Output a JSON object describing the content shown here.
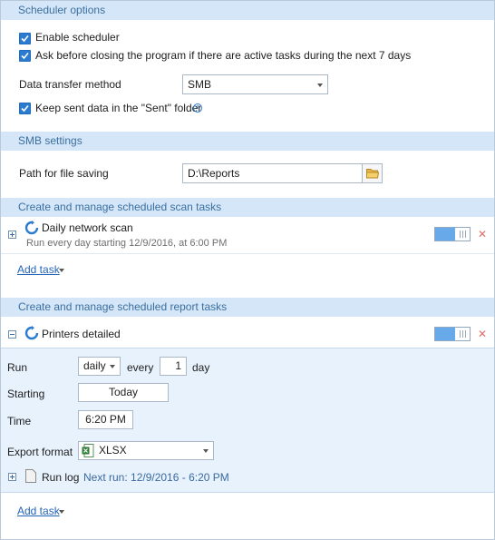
{
  "sections": {
    "scheduler_options": "Scheduler options",
    "smb_settings": "SMB settings",
    "scan_tasks": "Create and manage scheduled scan tasks",
    "report_tasks": "Create and manage scheduled report tasks"
  },
  "scheduler": {
    "enable_label": "Enable scheduler",
    "enable_checked": true,
    "ask_label": "Ask before closing the program if there are active tasks during the next 7 days",
    "ask_checked": true,
    "transfer_label": "Data transfer method",
    "transfer_value": "SMB",
    "keep_label": "Keep sent data in the \"Sent\" folder",
    "keep_checked": true
  },
  "smb": {
    "path_label": "Path for file saving",
    "path_value": "D:\\Reports"
  },
  "scan_task": {
    "name": "Daily network scan",
    "subtitle": "Run every day starting 12/9/2016, at 6:00 PM",
    "enabled": true,
    "add_task": "Add task"
  },
  "report_task": {
    "name": "Printers detailed",
    "enabled": true,
    "run_label": "Run",
    "run_value": "daily",
    "every_label": "every",
    "every_value": "1",
    "unit_label": "day",
    "starting_label": "Starting",
    "starting_value": "Today",
    "time_label": "Time",
    "time_value": "6:20 PM",
    "export_label": "Export format",
    "export_value": "XLSX",
    "runlog_label": "Run log",
    "next_run": "Next run: 12/9/2016 - 6:20 PM",
    "add_task": "Add task"
  },
  "colors": {
    "section_bg": "#d4e6f7",
    "accent": "#2b7bd0",
    "panel_bg": "#e8f2fc"
  }
}
